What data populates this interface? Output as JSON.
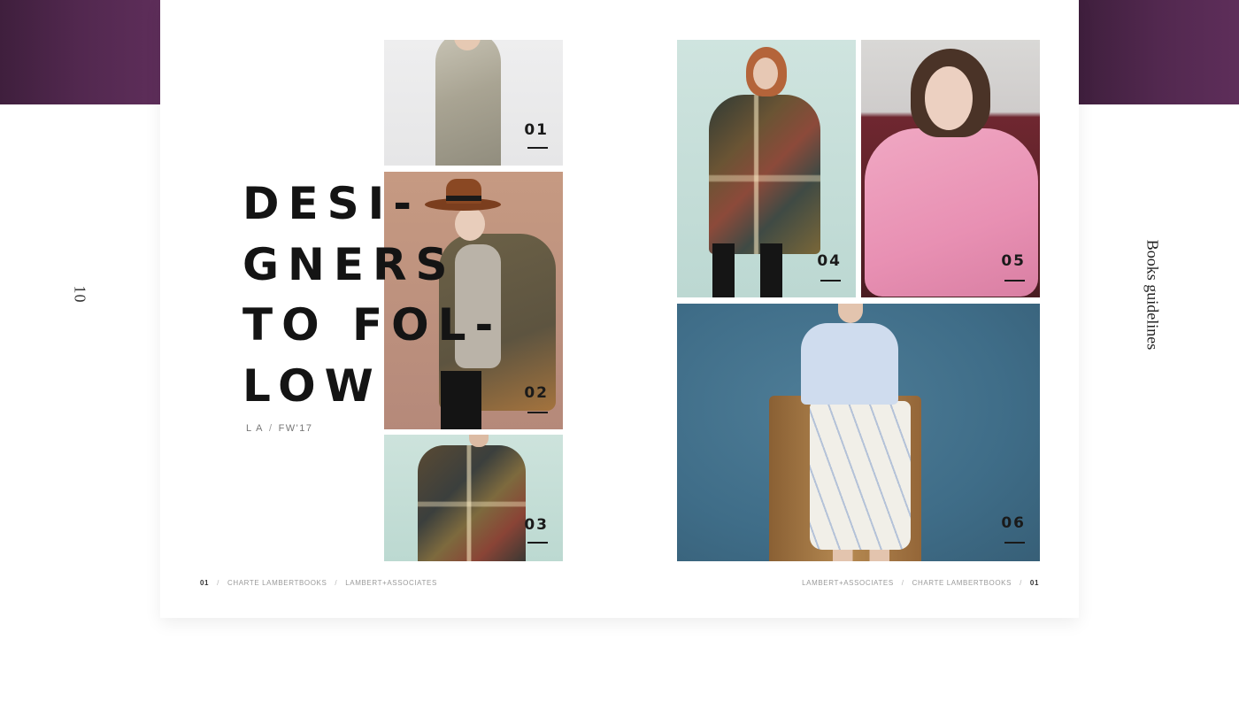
{
  "side": {
    "page_number": "10",
    "section_title": "Books guidelines"
  },
  "headline": {
    "lines": [
      "DESI-",
      "GNERS",
      "TO FOL-",
      "LOW"
    ]
  },
  "subline": {
    "brand": "L A",
    "separator": "/",
    "season": "FW'17"
  },
  "photos": [
    {
      "number": "01",
      "subject": "silver floral dress"
    },
    {
      "number": "02",
      "subject": "brown hat and olive jacket"
    },
    {
      "number": "03",
      "subject": "plaid poncho"
    },
    {
      "number": "04",
      "subject": "plaid poncho full length"
    },
    {
      "number": "05",
      "subject": "pink sweater"
    },
    {
      "number": "06",
      "subject": "white shirt and printed skirt"
    }
  ],
  "footer_left": {
    "page": "01",
    "separator": "/",
    "item1": "CHARTE LAMBERTBOOKS",
    "item2": "LAMBERT+ASSOCIATES"
  },
  "footer_right": {
    "item1": "LAMBERT+ASSOCIATES",
    "separator": "/",
    "item2": "CHARTE LAMBERTBOOKS",
    "page": "01"
  },
  "colors": {
    "band": "#52284f",
    "text": "#141414"
  }
}
